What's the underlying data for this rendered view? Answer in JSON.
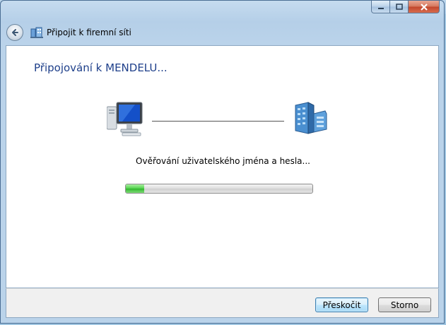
{
  "window": {
    "title": "Připojit k firemní síti",
    "caption_buttons": {
      "minimize": "–",
      "maximize": "□",
      "close": "✕"
    }
  },
  "content": {
    "heading": "Připojování k MENDELU...",
    "status_text": "Ověřování uživatelského jména a hesla...",
    "progress": {
      "value_fraction": 0.1,
      "color": "#3cc43a"
    }
  },
  "footer": {
    "skip_label": "Přeskočit",
    "cancel_label": "Storno"
  },
  "icons": {
    "back": "back-arrow-icon",
    "network": "network-icon",
    "computer": "computer-icon",
    "server": "server-icon"
  },
  "colors": {
    "heading": "#1e3f8a",
    "frame": "#b5cfe8",
    "close_button": "#c2452b"
  }
}
